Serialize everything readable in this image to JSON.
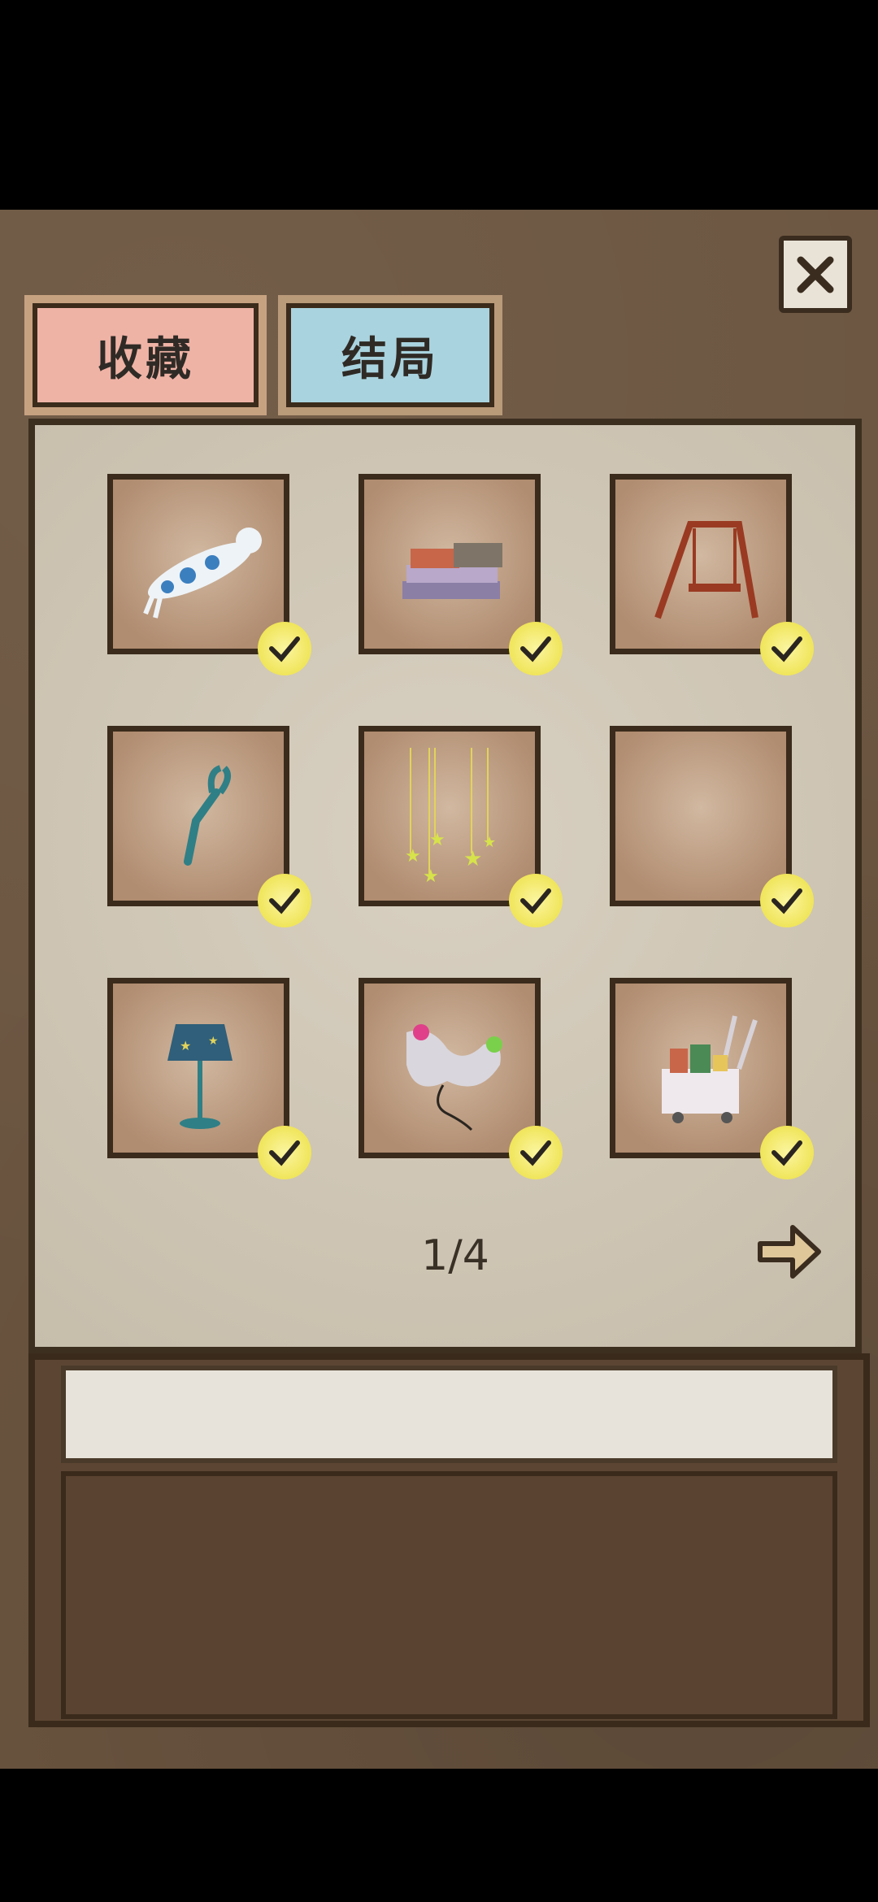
{
  "tabs": {
    "collection_label": "收藏",
    "ending_label": "结局"
  },
  "items": [
    {
      "name": "cat pillow",
      "collected": true
    },
    {
      "name": "stack of clothes",
      "collected": true
    },
    {
      "name": "wooden swing",
      "collected": true
    },
    {
      "name": "grabber claw",
      "collected": true
    },
    {
      "name": "hanging stars",
      "collected": true
    },
    {
      "name": "empty slot",
      "collected": true
    },
    {
      "name": "star lamp",
      "collected": true
    },
    {
      "name": "game controller",
      "collected": true
    },
    {
      "name": "shopping cart",
      "collected": true
    }
  ],
  "pagination": {
    "current": 1,
    "total": 4,
    "label": "1/4"
  },
  "description": {
    "title": "",
    "body": ""
  },
  "colors": {
    "collection_tab": "#efb3a6",
    "ending_tab": "#a9d3df",
    "check_badge": "#f0e55a"
  }
}
